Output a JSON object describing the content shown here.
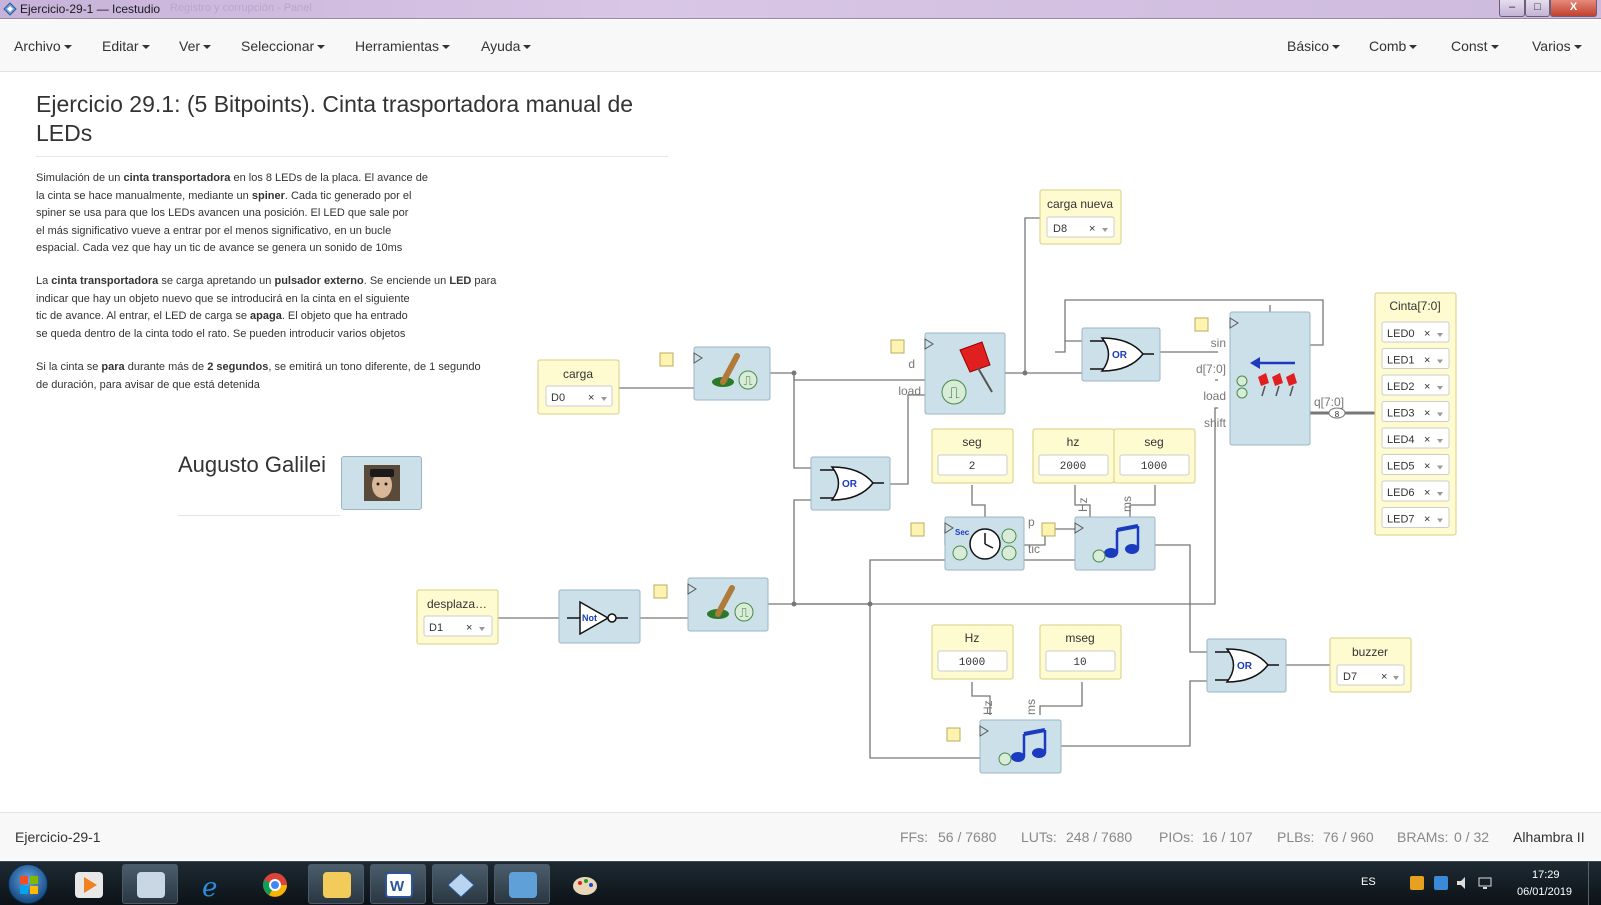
{
  "window": {
    "title": "Ejercicio-29-1 — Icestudio",
    "faded_title": "Registro y corrupción - Panel",
    "buttons": {
      "minimize": "–",
      "maximize": "□",
      "close": "X"
    }
  },
  "menubar": {
    "left": [
      "Archivo",
      "Editar",
      "Ver",
      "Seleccionar",
      "Herramientas",
      "Ayuda"
    ],
    "right": [
      "Básico",
      "Comb",
      "Const",
      "Varios"
    ]
  },
  "description": {
    "title": "Ejercicio 29.1: (5 Bitpoints). Cinta trasportadora manual de LEDs",
    "p1": "Simulación de un <b>cinta transportadora</b> en los 8 LEDs de la placa. El avance de<br>la cinta se hace manualmente, mediante un <b>spiner</b>. Cada tic generado por el<br>spiner se usa para que los LEDs avancen una posición. El LED que sale por<br>el más significativo vueve a entrar por el menos significativo, en un bucle<br>espacial. Cada vez que hay un tic de avance se genera un sonido de 10ms",
    "p2": "La <b>cinta transportadora</b> se carga apretando un <b>pulsador externo</b>. Se enciende un <b>LED</b> para<br>indicar que hay un objeto nuevo que se introducirá en la cinta en el siguiente<br>tic de avance. Al entrar, el LED de carga se <b>apaga</b>. El objeto que ha entrado<br>se queda dentro de la cinta todo el rato. Se pueden introducir varios objetos",
    "p3": "Si la cinta se <b>para</b> durante más de <b>2 segundos</b>, se emitirá un tono diferente, de 1 segundo<br>de duración, para avisar de que está detenida",
    "author": "Augusto Galilei"
  },
  "circuit": {
    "inputs": [
      {
        "label": "carga",
        "pin": "D0"
      },
      {
        "label": "desplaza…",
        "pin": "D1"
      },
      {
        "label": "carga nueva",
        "pin": "D8"
      }
    ],
    "outputs": [
      {
        "label": "buzzer",
        "pin": "D7"
      }
    ],
    "led_bus": {
      "label": "Cinta[7:0]",
      "pins": [
        "LED0",
        "LED1",
        "LED2",
        "LED3",
        "LED4",
        "LED5",
        "LED6",
        "LED7"
      ]
    },
    "constants": [
      {
        "label": "seg",
        "value": "2"
      },
      {
        "label": "hz",
        "value": "2000"
      },
      {
        "label": "seg",
        "value": "1000"
      },
      {
        "label": "Hz",
        "value": "1000"
      },
      {
        "label": "mseg",
        "value": "10"
      }
    ],
    "gate_labels": {
      "or": "OR",
      "not": "Not",
      "sec": "Sec"
    },
    "port_labels": {
      "d": "d",
      "load": "load",
      "sin": "sin",
      "d70": "d[7:0]",
      "load2": "load",
      "shift": "shift",
      "q70": "q[7:0]",
      "bus_width": "8",
      "p": "p",
      "tic": "tic",
      "hz_a": "Hz",
      "ms_a": "ms",
      "hz_b": "Hz",
      "ms_b": "ms"
    },
    "clear_symbol": "×"
  },
  "statusbar": {
    "project": "Ejercicio-29-1",
    "ffs_label": "FFs:",
    "ffs": "56 / 7680",
    "luts_label": "LUTs:",
    "luts": "248 / 7680",
    "pios_label": "PIOs:",
    "pios": "16 / 107",
    "plbs_label": "PLBs:",
    "plbs": "76 / 960",
    "brams_label": "BRAMs:",
    "brams": "0 / 32",
    "board": "Alhambra II"
  },
  "taskbar": {
    "lang": "ES",
    "time": "17:29",
    "date": "06/01/2019",
    "apps": [
      "media-player-icon",
      "calculator-icon",
      "internet-explorer-icon",
      "chrome-icon",
      "file-explorer-icon",
      "word-icon",
      "icestudio-icon",
      "screen-capture-icon",
      "paint-icon"
    ]
  },
  "colors": {
    "block": "#cce0ea",
    "io": "#fffbd0",
    "wire": "#777777"
  }
}
